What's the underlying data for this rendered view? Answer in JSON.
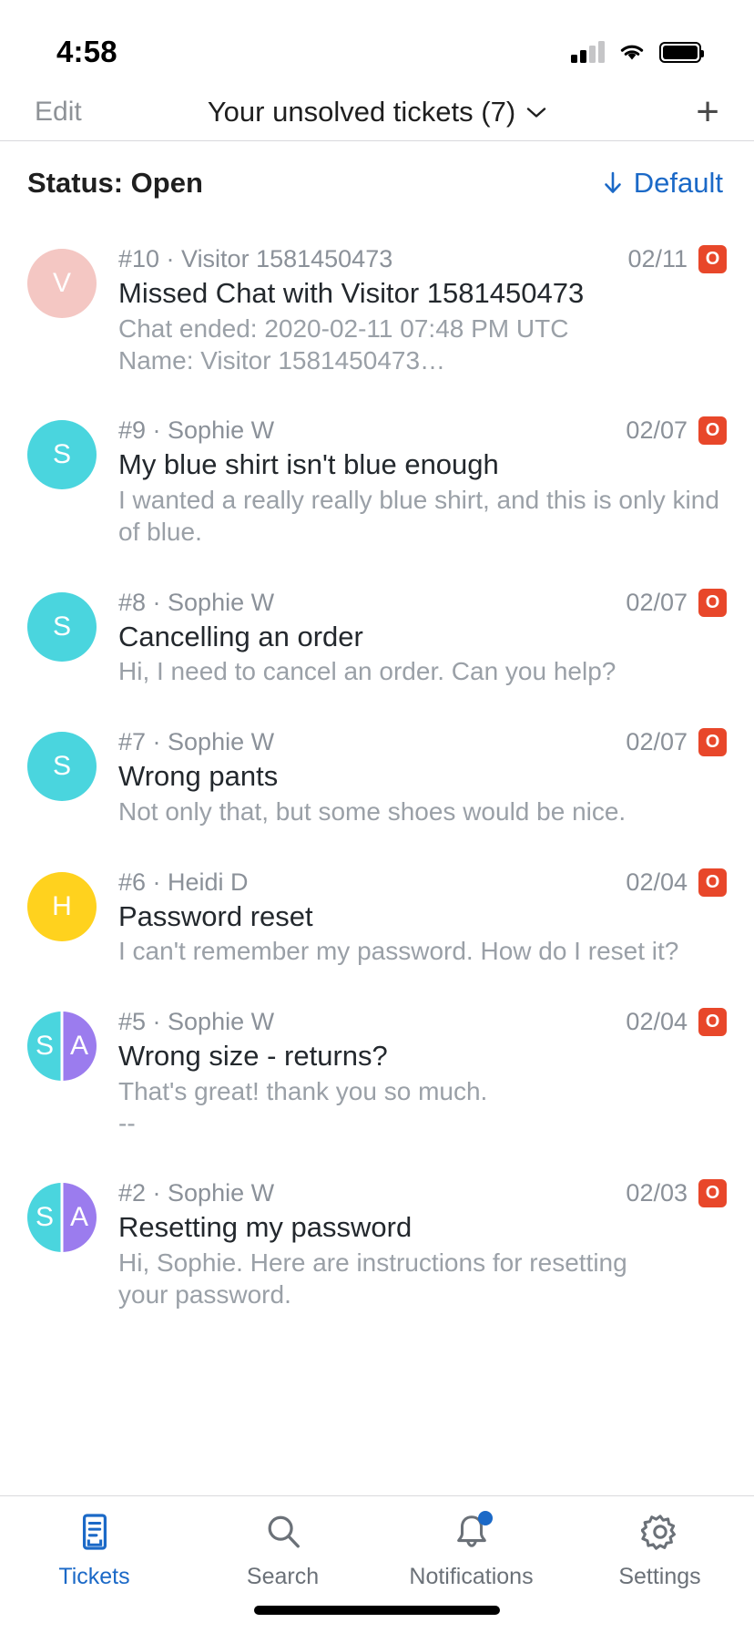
{
  "status_bar": {
    "time": "4:58",
    "icons": {
      "cellular": "signal-bars-icon",
      "wifi": "wifi-icon",
      "battery": "battery-icon"
    }
  },
  "nav": {
    "edit_label": "Edit",
    "title": "Your unsolved tickets (7)",
    "chevron": "chevron-down-icon",
    "add_label": "+"
  },
  "filter": {
    "status_label": "Status: Open",
    "sort_label": "Default",
    "sort_arrow": "arrow-down-icon",
    "sort_color": "#1b69c7"
  },
  "colors": {
    "accent": "#1b69c7",
    "badge_open": "#e8472a",
    "avatar_pink": "#f4c7c3",
    "avatar_cyan": "#4ad5de",
    "avatar_yellow": "#ffd21e",
    "avatar_purple": "#9b7cee",
    "text_primary": "#23282d",
    "text_secondary": "#8b9199",
    "text_muted": "#9aa0a7"
  },
  "tickets": [
    {
      "id": "#10",
      "requester": "Visitor 1581450473",
      "meta": "#10 · Visitor 1581450473",
      "subject": "Missed Chat with Visitor 1581450473",
      "preview_lines": [
        "Chat ended: 2020-02-11 07:48 PM UTC",
        "Name: Visitor 1581450473…"
      ],
      "date": "02/11",
      "badge": "O",
      "avatar": {
        "split": false,
        "initials": [
          "V"
        ],
        "colors": [
          "#f4c7c3"
        ]
      }
    },
    {
      "id": "#9",
      "requester": "Sophie W",
      "meta": "#9 · Sophie W",
      "subject": "My blue shirt isn't blue enough",
      "preview_lines": [
        "I wanted a really really blue shirt, and this is only kind",
        "of blue."
      ],
      "date": "02/07",
      "badge": "O",
      "avatar": {
        "split": false,
        "initials": [
          "S"
        ],
        "colors": [
          "#4ad5de"
        ]
      }
    },
    {
      "id": "#8",
      "requester": "Sophie W",
      "meta": "#8 · Sophie W",
      "subject": "Cancelling an order",
      "preview_lines": [
        "Hi, I need to cancel an order. Can you help?"
      ],
      "date": "02/07",
      "badge": "O",
      "avatar": {
        "split": false,
        "initials": [
          "S"
        ],
        "colors": [
          "#4ad5de"
        ]
      }
    },
    {
      "id": "#7",
      "requester": "Sophie W",
      "meta": "#7 · Sophie W",
      "subject": "Wrong pants",
      "preview_lines": [
        "Not only that, but some shoes would be nice."
      ],
      "date": "02/07",
      "badge": "O",
      "avatar": {
        "split": false,
        "initials": [
          "S"
        ],
        "colors": [
          "#4ad5de"
        ]
      }
    },
    {
      "id": "#6",
      "requester": "Heidi D",
      "meta": "#6 · Heidi D",
      "subject": "Password reset",
      "preview_lines": [
        "I can't remember my password. How do I reset it?"
      ],
      "date": "02/04",
      "badge": "O",
      "avatar": {
        "split": false,
        "initials": [
          "H"
        ],
        "colors": [
          "#ffd21e"
        ]
      }
    },
    {
      "id": "#5",
      "requester": "Sophie W",
      "meta": "#5 · Sophie W",
      "subject": "Wrong size - returns?",
      "preview_lines": [
        "That's great! thank you so much.",
        "--"
      ],
      "date": "02/04",
      "badge": "O",
      "avatar": {
        "split": true,
        "initials": [
          "S",
          "A"
        ],
        "colors": [
          "#4ad5de",
          "#9b7cee"
        ]
      }
    },
    {
      "id": "#2",
      "requester": "Sophie W",
      "meta": "#2 · Sophie W",
      "subject": "Resetting my password",
      "preview_lines": [
        "Hi, Sophie. Here are instructions for resetting",
        "your password."
      ],
      "date": "02/03",
      "badge": "O",
      "avatar": {
        "split": true,
        "initials": [
          "S",
          "A"
        ],
        "colors": [
          "#4ad5de",
          "#9b7cee"
        ]
      }
    }
  ],
  "tabbar": {
    "items": [
      {
        "label": "Tickets",
        "icon": "ticket-icon",
        "active": true,
        "badge": false
      },
      {
        "label": "Search",
        "icon": "search-icon",
        "active": false,
        "badge": false
      },
      {
        "label": "Notifications",
        "icon": "bell-icon",
        "active": false,
        "badge": true
      },
      {
        "label": "Settings",
        "icon": "gear-icon",
        "active": false,
        "badge": false
      }
    ]
  }
}
